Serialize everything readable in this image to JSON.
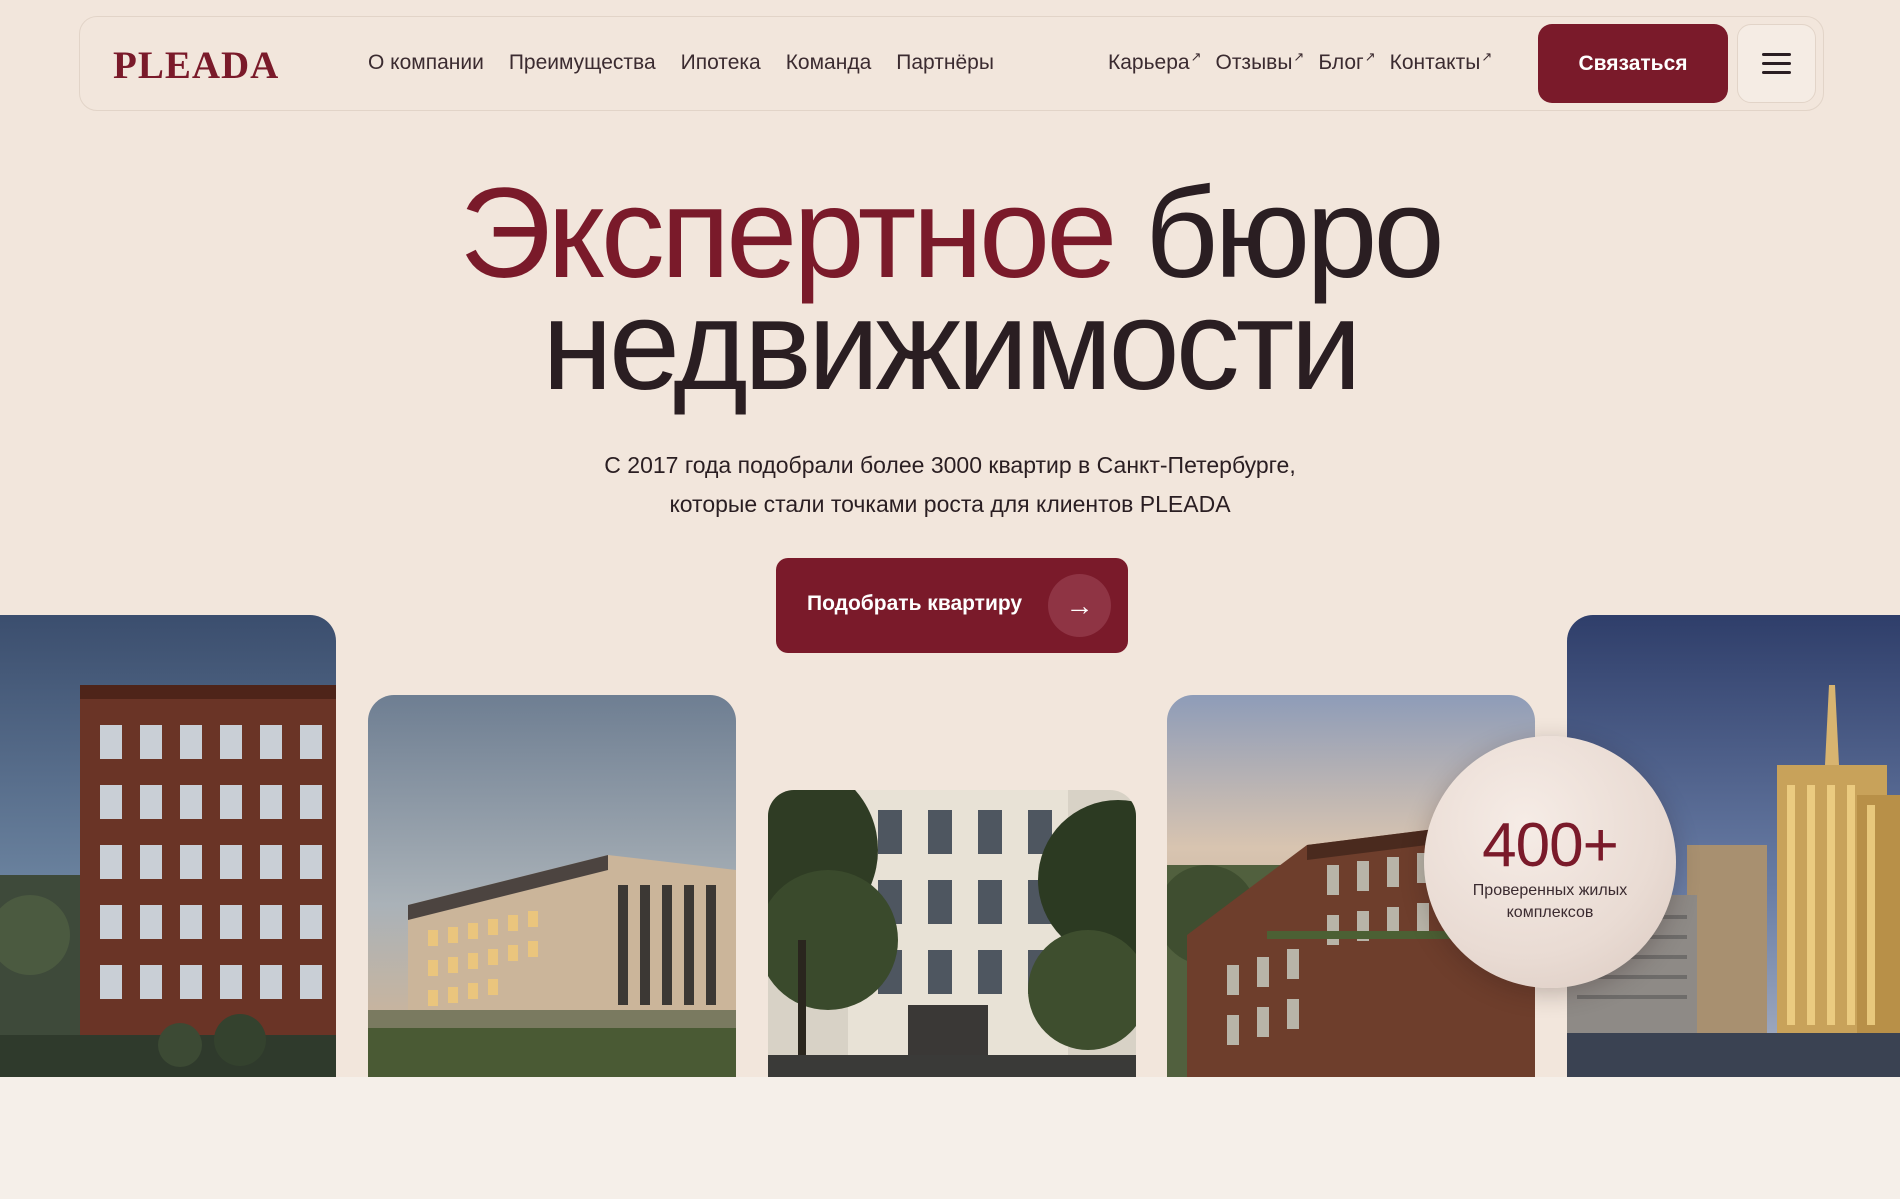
{
  "header": {
    "logo": "PLEADA",
    "nav_main": [
      {
        "label": "О компании"
      },
      {
        "label": "Преимущества"
      },
      {
        "label": "Ипотека"
      },
      {
        "label": "Команда"
      },
      {
        "label": "Партнёры"
      }
    ],
    "nav_external": [
      {
        "label": "Карьера"
      },
      {
        "label": "Отзывы"
      },
      {
        "label": "Блог"
      },
      {
        "label": "Контакты"
      }
    ],
    "external_icon": "arrow-up-right-icon",
    "contact_button": "Связаться",
    "menu_icon": "hamburger-menu-icon"
  },
  "hero": {
    "title_accent": "Экспертное",
    "title_rest_line1": "бюро",
    "title_line2": "недвижимости",
    "subtitle_line1": "С 2017 года подобрали более 3000 квартир в Санкт-Петербурге,",
    "subtitle_line2": "которые стали точками роста для клиентов PLEADA",
    "cta_label": "Подобрать квартиру",
    "cta_icon": "arrow-right-icon"
  },
  "stat": {
    "number": "400+",
    "label": "Проверенных жилых комплексов"
  },
  "colors": {
    "accent": "#7a1a2a",
    "background": "#f2e6dc",
    "text": "#2a1e22"
  }
}
